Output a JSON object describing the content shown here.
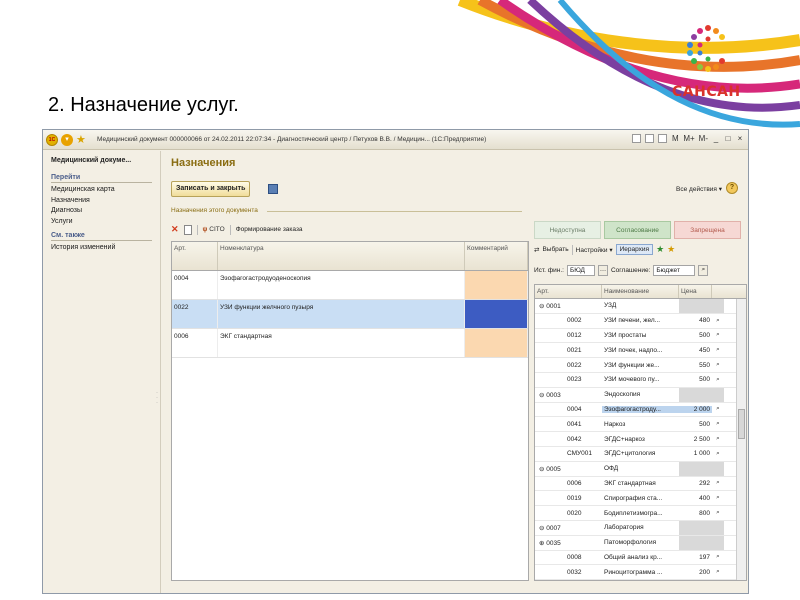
{
  "slide": {
    "title": "2. Назначение услуг.",
    "logo_text": "САНСАН"
  },
  "window": {
    "title": "Медицинский документ 000000066 от 24.02.2011 22:07:34 - Диагностический центр / Петухов В.В. / Медицин... (1С:Предприятие)",
    "controls": [
      "M",
      "M+",
      "M-",
      "_",
      "□",
      "×"
    ]
  },
  "sidebar": {
    "title": "Медицинский докуме...",
    "section_go": "Перейти",
    "items": [
      "Медицинская карта",
      "Назначения",
      "Диагнозы",
      "Услуги"
    ],
    "section_see_also": "См. также",
    "see_also_items": [
      "История изменений"
    ]
  },
  "form": {
    "title": "Назначения",
    "save_close": "Записать и закрыть",
    "all_actions": "Все действия ▾",
    "help": "?",
    "group_label": "Назначения этого документа",
    "cito": "CITO",
    "form_order": "Формирование заказа"
  },
  "left_table": {
    "headers": [
      "Арт.",
      "Номенклатура",
      "Комментарий"
    ],
    "rows": [
      {
        "art": "0004",
        "name": "Эзофагогастродуоденоскопия"
      },
      {
        "art": "0022",
        "name": "УЗИ функции желчного пузыря"
      },
      {
        "art": "0006",
        "name": "ЭКГ стандартная"
      }
    ]
  },
  "right_panel": {
    "status": [
      "Недоступна",
      "Согласование",
      "Запрещена"
    ],
    "choose": "Выбрать",
    "settings": "Настройки ▾",
    "hierarchy": "Иерархия",
    "fin_label": "Ист. фин.:",
    "fin_value": "БЮД",
    "agreement_label": "Соглашение:",
    "agreement_value": "Бюджет пре",
    "headers": [
      "Арт.",
      "Наименование",
      "Цена"
    ],
    "rows": [
      {
        "art": "⊖  0001",
        "name": "УЗД",
        "price": "",
        "group": true
      },
      {
        "art": "0002",
        "name": "УЗИ печени, жел...",
        "price": "480"
      },
      {
        "art": "0012",
        "name": "УЗИ простаты",
        "price": "500"
      },
      {
        "art": "0021",
        "name": "УЗИ почек, надпо...",
        "price": "450"
      },
      {
        "art": "0022",
        "name": "УЗИ функции же...",
        "price": "550"
      },
      {
        "art": "0023",
        "name": "УЗИ мочевого пу...",
        "price": "500"
      },
      {
        "art": "⊖  0003",
        "name": "Эндоскопия",
        "price": "",
        "group": true
      },
      {
        "art": "0004",
        "name": "Эзофагогастроду...",
        "price": "2 000",
        "hl": true
      },
      {
        "art": "0041",
        "name": "Наркоз",
        "price": "500"
      },
      {
        "art": "0042",
        "name": "ЭГДС+наркоз",
        "price": "2 500"
      },
      {
        "art": "СМУ001",
        "name": "ЭГДС+цитология",
        "price": "1 000"
      },
      {
        "art": "⊖  0005",
        "name": "ОФД",
        "price": "",
        "group": true
      },
      {
        "art": "0006",
        "name": "ЭКГ стандартная",
        "price": "292"
      },
      {
        "art": "0019",
        "name": "Спирография ста...",
        "price": "400"
      },
      {
        "art": "0020",
        "name": "Бодиплетизмогра...",
        "price": "800"
      },
      {
        "art": "⊖  0007",
        "name": "Лаборатория",
        "price": "",
        "group": true
      },
      {
        "art": "⊕  0035",
        "name": "Патоморфология",
        "price": "",
        "group": true
      },
      {
        "art": "0008",
        "name": "Общий анализ кр...",
        "price": "197"
      },
      {
        "art": "0032",
        "name": "Риноцитограмма ...",
        "price": "200"
      }
    ]
  }
}
